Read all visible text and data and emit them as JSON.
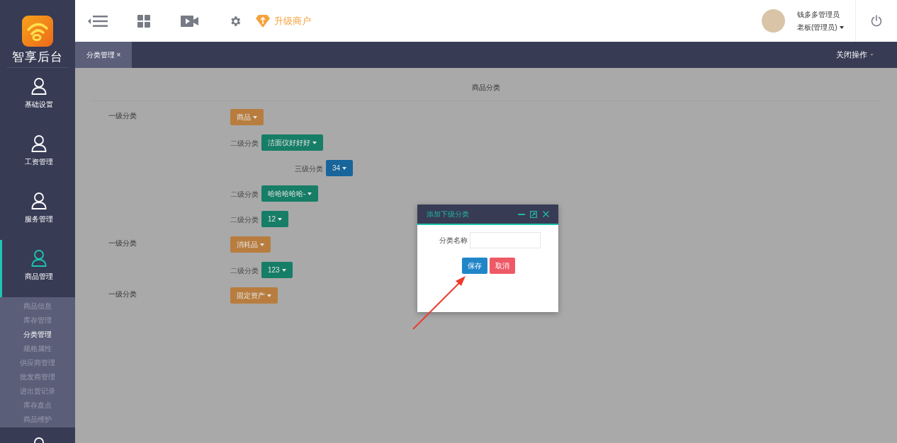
{
  "brand": {
    "name": "智享后台"
  },
  "toolbar": {
    "upgrade_label": "升级商户"
  },
  "user": {
    "name": "钱多多管理员",
    "role": "老板(管理员)"
  },
  "tabs": [
    {
      "label": "分类管理",
      "close": "×",
      "selected": true
    }
  ],
  "close_menu": {
    "label": "关闭操作"
  },
  "sidebar": {
    "items": [
      {
        "label": "基础设置",
        "selected": false
      },
      {
        "label": "工资管理",
        "selected": false
      },
      {
        "label": "服务管理",
        "selected": false
      },
      {
        "label": "商品管理",
        "selected": true,
        "children": [
          {
            "label": "商品信息",
            "selected": false
          },
          {
            "label": "库存管理",
            "selected": false
          },
          {
            "label": "分类管理",
            "selected": true
          },
          {
            "label": "规格属性",
            "selected": false
          },
          {
            "label": "供应商管理",
            "selected": false
          },
          {
            "label": "批发商管理",
            "selected": false
          },
          {
            "label": "进出货记录",
            "selected": false
          },
          {
            "label": "库存盘点",
            "selected": false
          },
          {
            "label": "商品维护",
            "selected": false
          }
        ]
      },
      {
        "selected": false
      }
    ]
  },
  "panel": {
    "title": "商品分类",
    "rows": [
      {
        "kind": "level1",
        "label": "一级分类",
        "value": "商品"
      },
      {
        "kind": "level2",
        "label": "二级分类",
        "value": "洁面仪好好好"
      },
      {
        "kind": "level3",
        "label": "三级分类",
        "value": "34"
      },
      {
        "kind": "level2",
        "label": "二级分类",
        "value": "哈哈哈哈哈-"
      },
      {
        "kind": "level2",
        "label": "二级分类",
        "value": "12"
      },
      {
        "kind": "level1",
        "label": "一级分类",
        "value": "消耗品"
      },
      {
        "kind": "level2",
        "label": "二级分类",
        "value": "123"
      },
      {
        "kind": "level1",
        "label": "一级分类",
        "value": "固定资产"
      }
    ]
  },
  "dialog": {
    "title": "添加下级分类",
    "field_label": "分类名称",
    "buttons": [
      {
        "kind": "primary",
        "label": "保存"
      },
      {
        "kind": "danger",
        "label": "取消"
      }
    ]
  }
}
